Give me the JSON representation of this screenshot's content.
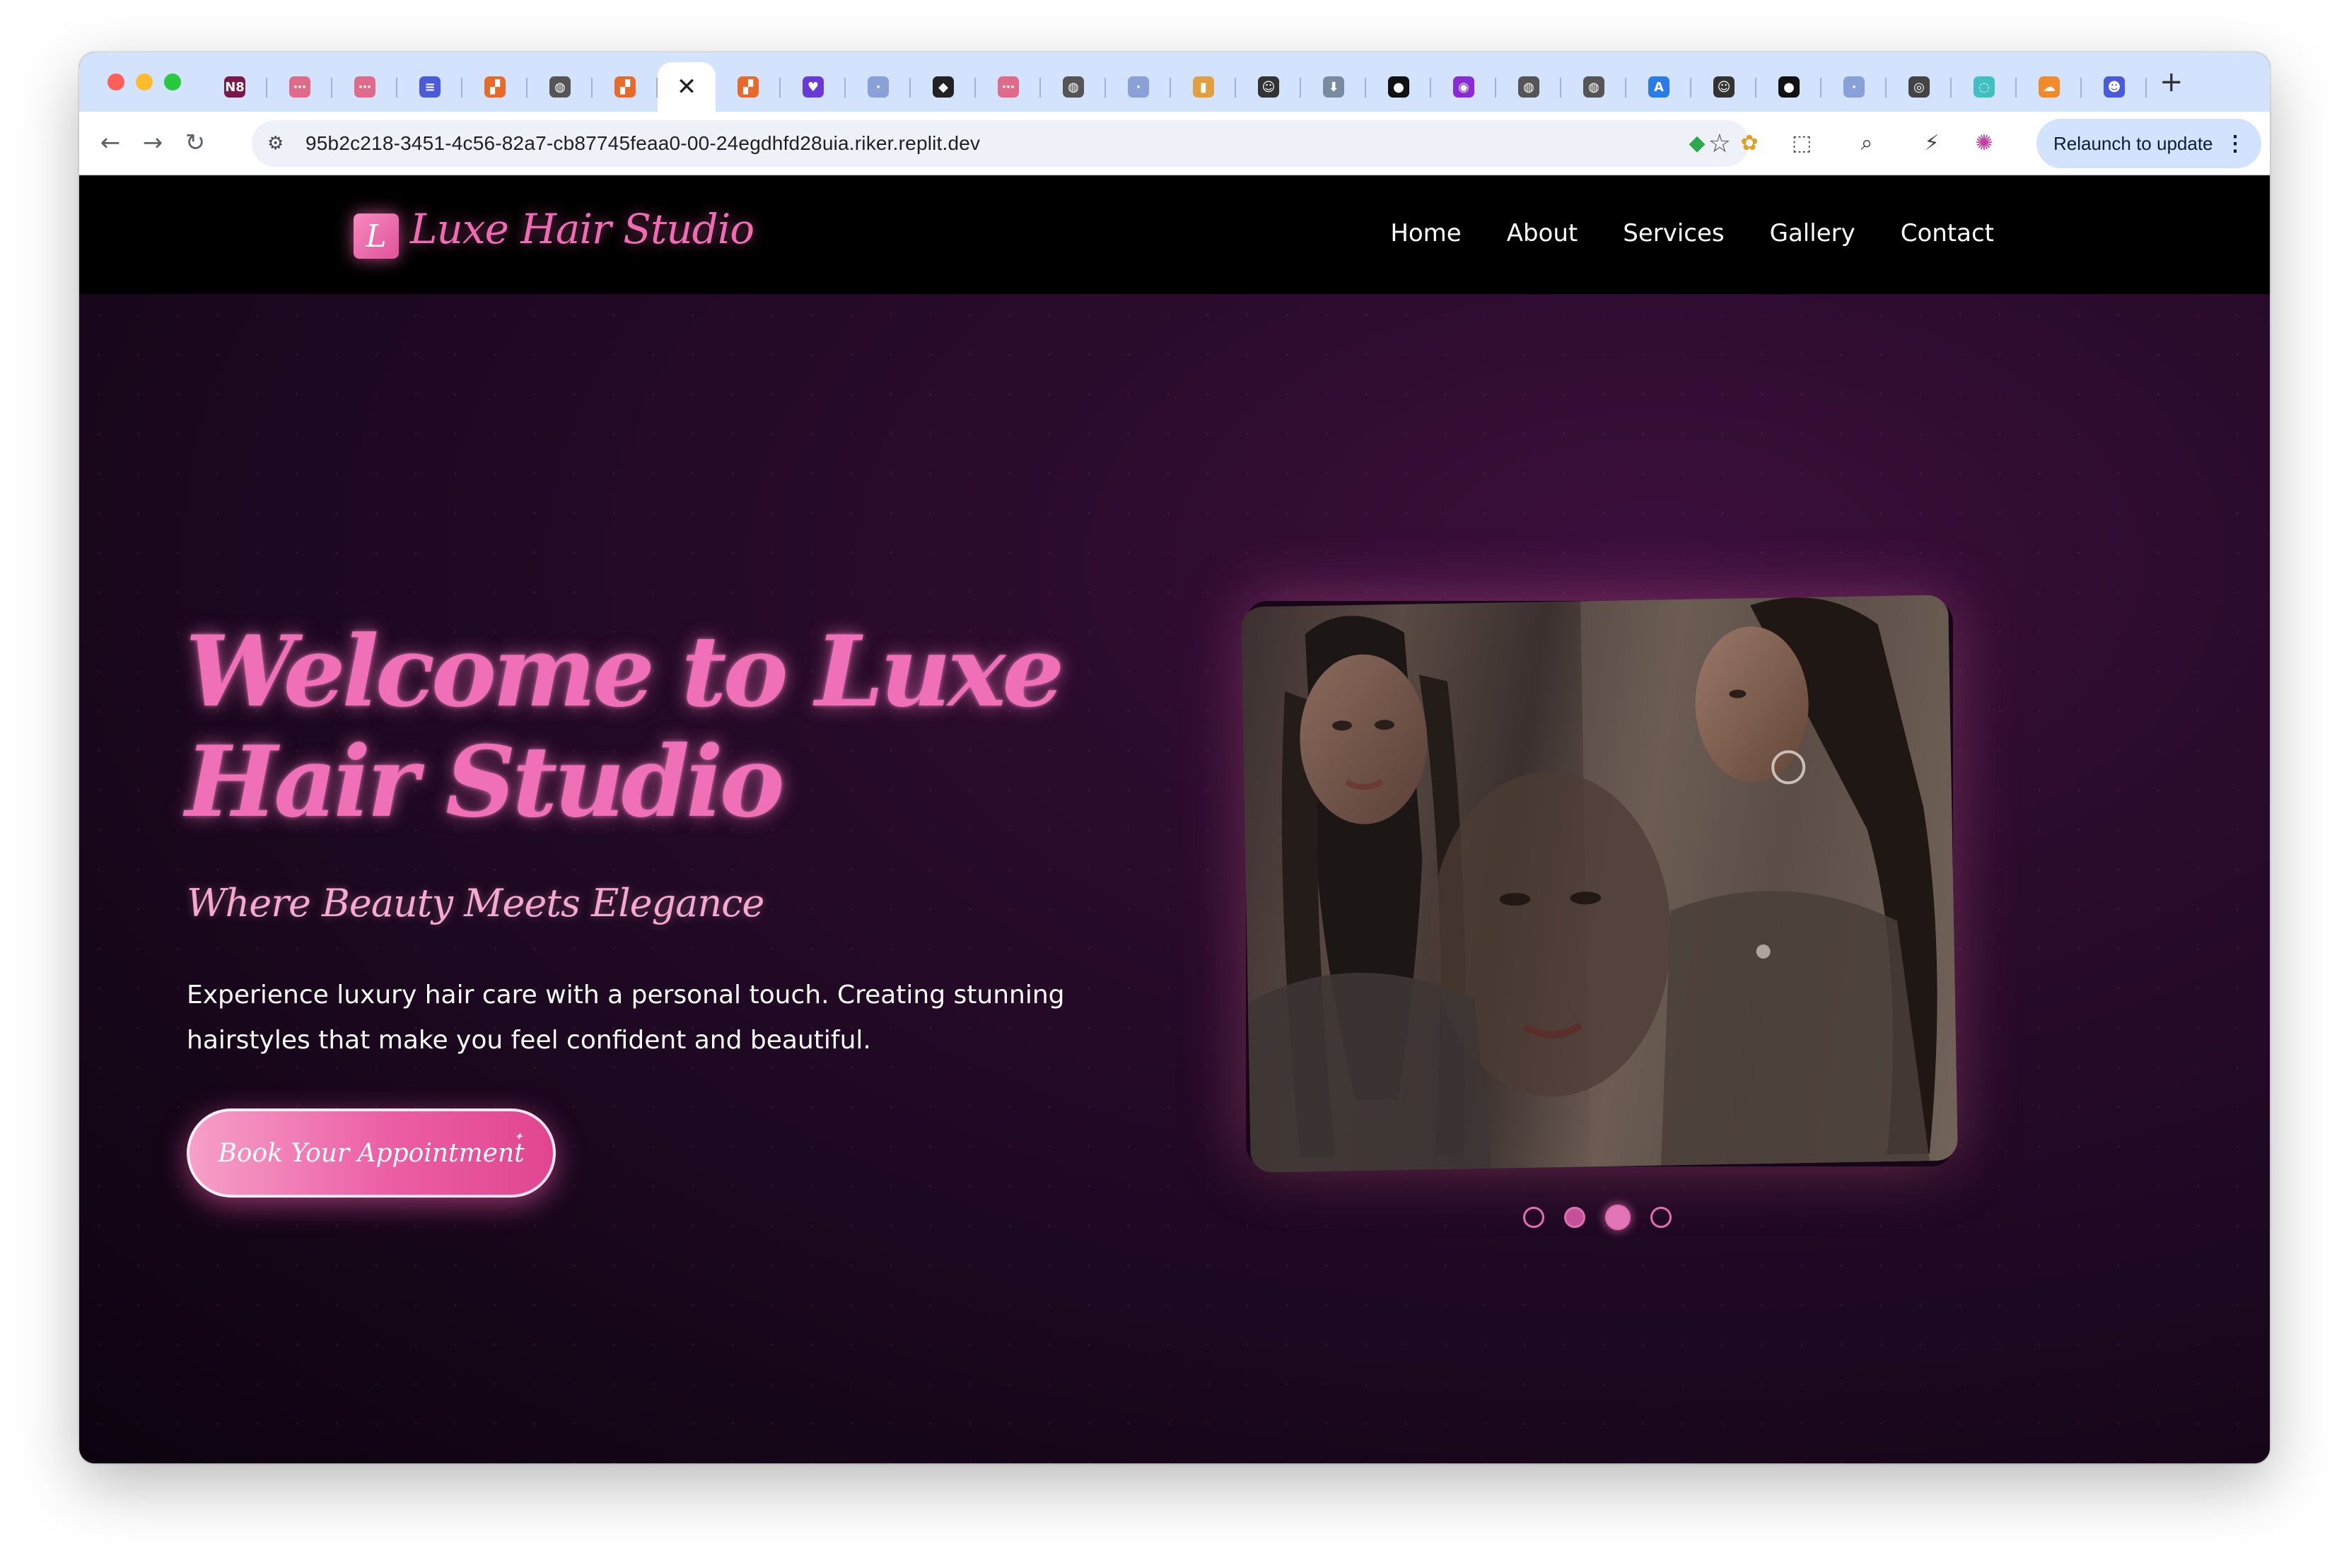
{
  "browser": {
    "tabs": [
      {
        "icon": "n8n-icon",
        "glyph": "N8",
        "color": "#7a1a4a"
      },
      {
        "icon": "workflow-icon",
        "glyph": "⋯",
        "color": "#e06a8a"
      },
      {
        "icon": "workflow-icon",
        "glyph": "⋯",
        "color": "#e06a8a"
      },
      {
        "icon": "doc-icon",
        "glyph": "≡",
        "color": "#4a5ad8"
      },
      {
        "icon": "make-icon",
        "glyph": "▞",
        "color": "#e86a2a"
      },
      {
        "icon": "globe-icon",
        "glyph": "◍",
        "color": "#555555"
      },
      {
        "icon": "make-icon",
        "glyph": "▞",
        "color": "#e86a2a"
      },
      {
        "icon": "close-icon",
        "glyph": "✕",
        "color": "#1f1f1f"
      },
      {
        "icon": "make-icon",
        "glyph": "▞",
        "color": "#e86a2a"
      },
      {
        "icon": "heart-shield-icon",
        "glyph": "♥",
        "color": "#6a3ad8"
      },
      {
        "icon": "dot-icon",
        "glyph": "·",
        "color": "#8aa0d8"
      },
      {
        "icon": "mask-icon",
        "glyph": "◆",
        "color": "#222222"
      },
      {
        "icon": "workflow-icon",
        "glyph": "⋯",
        "color": "#e06a8a"
      },
      {
        "icon": "globe-icon",
        "glyph": "◍",
        "color": "#555555"
      },
      {
        "icon": "dot-icon",
        "glyph": "·",
        "color": "#8aa0d8"
      },
      {
        "icon": "chart-icon",
        "glyph": "▮",
        "color": "#e0a040"
      },
      {
        "icon": "avatar-icon",
        "glyph": "☺",
        "color": "#333333"
      },
      {
        "icon": "download-icon",
        "glyph": "⬇",
        "color": "#7a8aa0"
      },
      {
        "icon": "github-icon",
        "glyph": "●",
        "color": "#111111"
      },
      {
        "icon": "coin-icon",
        "glyph": "◉",
        "color": "#8a2ad8"
      },
      {
        "icon": "globe-icon",
        "glyph": "◍",
        "color": "#555555"
      },
      {
        "icon": "globe-icon",
        "glyph": "◍",
        "color": "#555555"
      },
      {
        "icon": "appstore-icon",
        "glyph": "A",
        "color": "#2a7ae8"
      },
      {
        "icon": "avatar-icon",
        "glyph": "☺",
        "color": "#333333"
      },
      {
        "icon": "github-icon",
        "glyph": "●",
        "color": "#111111"
      },
      {
        "icon": "dot-icon",
        "glyph": "·",
        "color": "#8aa0d8"
      },
      {
        "icon": "chrome-icon",
        "glyph": "◎",
        "color": "#444444"
      },
      {
        "icon": "leaf-icon",
        "glyph": "◌",
        "color": "#40c0c0"
      },
      {
        "icon": "cloudflare-icon",
        "glyph": "☁",
        "color": "#f08a2a"
      },
      {
        "icon": "discord-icon",
        "glyph": "☻",
        "color": "#4a5ad8"
      }
    ],
    "new_tab": "+",
    "url": "95b2c218-3451-4c56-82a7-cb87745feaa0-00-24egdhfd28uia.riker.replit.dev",
    "relaunch_label": "Relaunch to update",
    "relaunch_dots": "⋮"
  },
  "site": {
    "logo_letter": "L",
    "logo_text": "Luxe Hair Studio",
    "nav": [
      "Home",
      "About",
      "Services",
      "Gallery",
      "Contact"
    ],
    "hero_title": "Welcome to Luxe Hair Studio",
    "hero_subtitle": "Where Beauty Meets Elegance",
    "hero_description": "Experience luxury hair care with a personal touch. Creating stunning hairstyles that make you feel confident and beautiful.",
    "cta_label": "Book Your Appointment",
    "carousel": {
      "slides": 4,
      "active_index": 2
    }
  },
  "colors": {
    "accent_pink": "#f070b8",
    "button_gradient_end": "#e0468f",
    "tabstrip_bg": "#d3e3fd"
  }
}
